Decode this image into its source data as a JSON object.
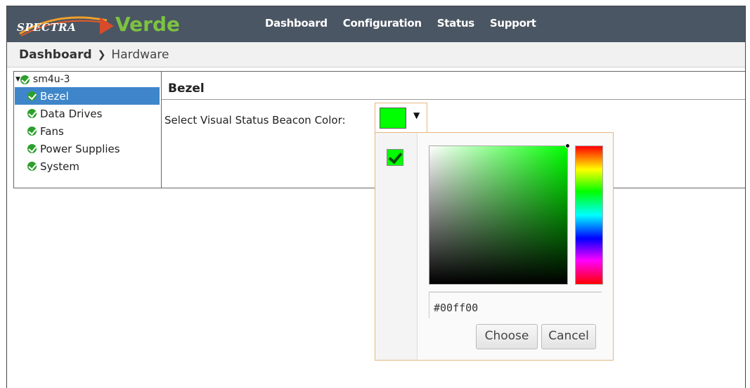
{
  "header": {
    "logo_spectra": "SPECTRA",
    "logo_verde": "Verde",
    "nav": [
      "Dashboard",
      "Configuration",
      "Status",
      "Support"
    ]
  },
  "breadcrumb": {
    "parent": "Dashboard",
    "current": "Hardware"
  },
  "tree": {
    "root": "sm4u-3",
    "items": [
      "Bezel",
      "Data Drives",
      "Fans",
      "Power Supplies",
      "System"
    ],
    "selected": "Bezel"
  },
  "panel": {
    "title": "Bezel",
    "beacon_label": "Select Visual Status Beacon Color:"
  },
  "color_picker": {
    "current_color": "#00ff00",
    "hex_value": "#00ff00",
    "choose_label": "Choose",
    "cancel_label": "Cancel"
  },
  "colors": {
    "topbar": "#4a5663",
    "brand_green": "#7dc242",
    "selected_item": "#3e86c9",
    "status_ok": "#2c9f2c"
  },
  "icons": [
    "check-circle-icon",
    "caret-down-icon",
    "chevron-right-icon",
    "dropdown-arrow-icon",
    "checkmark-icon"
  ]
}
